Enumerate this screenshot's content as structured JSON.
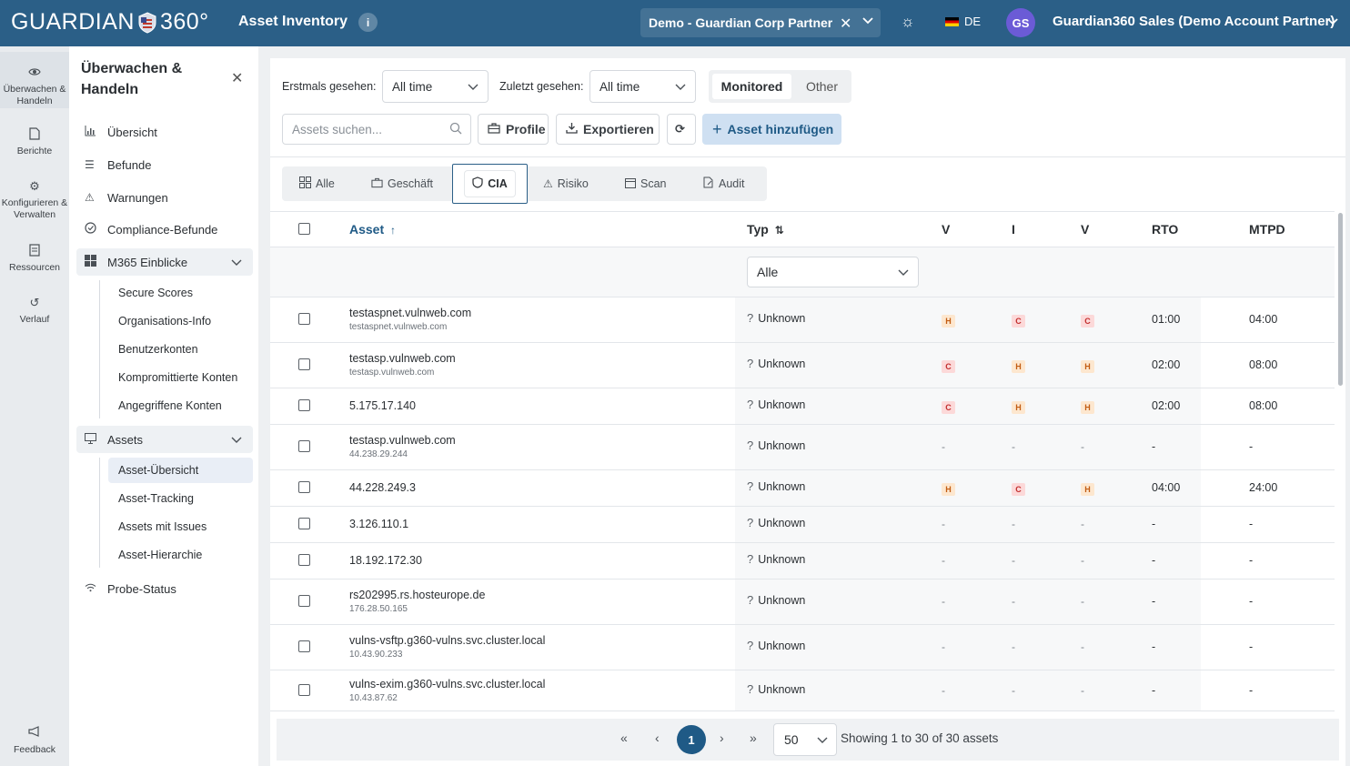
{
  "header": {
    "brand_left": "GUARDIAN",
    "brand_right": "360°",
    "app_title": "Asset Inventory",
    "info_icon": "info-icon",
    "tenant": "Demo - Guardian Corp Partner",
    "language": "DE",
    "avatar_initials": "GS",
    "account_name": "Guardian360 Sales (Demo Account Partner)"
  },
  "rail": {
    "items": [
      {
        "label": "Überwachen & Handeln",
        "icon": "eye-icon"
      },
      {
        "label": "Berichte",
        "icon": "document-icon"
      },
      {
        "label": "Konfigurieren & Verwalten",
        "icon": "gear-icon"
      },
      {
        "label": "Ressourcen",
        "icon": "book-icon"
      },
      {
        "label": "Verlauf",
        "icon": "history-icon"
      }
    ],
    "feedback": "Feedback"
  },
  "sidebar": {
    "title": "Überwachen & Handeln",
    "items": [
      {
        "label": "Übersicht",
        "icon": "bar-chart-icon"
      },
      {
        "label": "Befunde",
        "icon": "list-icon"
      },
      {
        "label": "Warnungen",
        "icon": "warning-icon"
      },
      {
        "label": "Compliance-Befunde",
        "icon": "check-circle-icon"
      },
      {
        "label": "M365 Einblicke",
        "icon": "windows-icon"
      },
      {
        "label": "Assets",
        "icon": "monitor-icon"
      },
      {
        "label": "Probe-Status",
        "icon": "wifi-icon"
      }
    ],
    "m365_sub": [
      "Secure Scores",
      "Organisations-Info",
      "Benutzerkonten",
      "Kompromittierte Konten",
      "Angegriffene Konten"
    ],
    "assets_sub": [
      "Asset-Übersicht",
      "Asset-Tracking",
      "Assets mit Issues",
      "Asset-Hierarchie"
    ]
  },
  "filters": {
    "first_seen_label": "Erstmals gesehen:",
    "first_seen_value": "All time",
    "last_seen_label": "Zuletzt gesehen:",
    "last_seen_value": "All time",
    "segment_on": "Monitored",
    "segment_off": "Other"
  },
  "actions": {
    "search_placeholder": "Assets suchen...",
    "profile": "Profile",
    "export": "Exportieren",
    "add_asset": "Asset hinzufügen"
  },
  "tabs": [
    "Alle",
    "Geschäft",
    "CIA",
    "Risiko",
    "Scan",
    "Audit"
  ],
  "table": {
    "columns": {
      "asset": "Asset",
      "typ": "Typ",
      "c": "V",
      "i": "I",
      "a": "V",
      "rto": "RTO",
      "mtpd": "MTPD"
    },
    "typ_filter": "Alle",
    "rows": [
      {
        "name": "testaspnet.vulnweb.com",
        "sub": "testaspnet.vulnweb.com",
        "type": "Unknown",
        "c": "H",
        "i": "C",
        "a": "C",
        "rto": "01:00",
        "mtpd": "04:00"
      },
      {
        "name": "testasp.vulnweb.com",
        "sub": "testasp.vulnweb.com",
        "type": "Unknown",
        "c": "C",
        "i": "H",
        "a": "H",
        "rto": "02:00",
        "mtpd": "08:00"
      },
      {
        "name": "5.175.17.140",
        "sub": "",
        "type": "Unknown",
        "c": "C",
        "i": "H",
        "a": "H",
        "rto": "02:00",
        "mtpd": "08:00"
      },
      {
        "name": "testasp.vulnweb.com",
        "sub": "44.238.29.244",
        "type": "Unknown",
        "c": "-",
        "i": "-",
        "a": "-",
        "rto": "-",
        "mtpd": "-"
      },
      {
        "name": "44.228.249.3",
        "sub": "",
        "type": "Unknown",
        "c": "H",
        "i": "C",
        "a": "H",
        "rto": "04:00",
        "mtpd": "24:00"
      },
      {
        "name": "3.126.110.1",
        "sub": "",
        "type": "Unknown",
        "c": "-",
        "i": "-",
        "a": "-",
        "rto": "-",
        "mtpd": "-"
      },
      {
        "name": "18.192.172.30",
        "sub": "",
        "type": "Unknown",
        "c": "-",
        "i": "-",
        "a": "-",
        "rto": "-",
        "mtpd": "-"
      },
      {
        "name": "rs202995.rs.hosteurope.de",
        "sub": "176.28.50.165",
        "type": "Unknown",
        "c": "-",
        "i": "-",
        "a": "-",
        "rto": "-",
        "mtpd": "-"
      },
      {
        "name": "vulns-vsftp.g360-vulns.svc.cluster.local",
        "sub": "10.43.90.233",
        "type": "Unknown",
        "c": "-",
        "i": "-",
        "a": "-",
        "rto": "-",
        "mtpd": "-"
      },
      {
        "name": "vulns-exim.g360-vulns.svc.cluster.local",
        "sub": "10.43.87.62",
        "type": "Unknown",
        "c": "-",
        "i": "-",
        "a": "-",
        "rto": "-",
        "mtpd": "-"
      }
    ]
  },
  "pagination": {
    "first": "«",
    "prev": "‹",
    "current": "1",
    "next": "›",
    "last": "»",
    "page_size": "50",
    "info": "Showing 1 to 30 of 30 assets"
  },
  "colors": {
    "header": "#2b5f87",
    "accent": "#1f5a86",
    "high": "#c25c12",
    "critical": "#c22e2e"
  }
}
